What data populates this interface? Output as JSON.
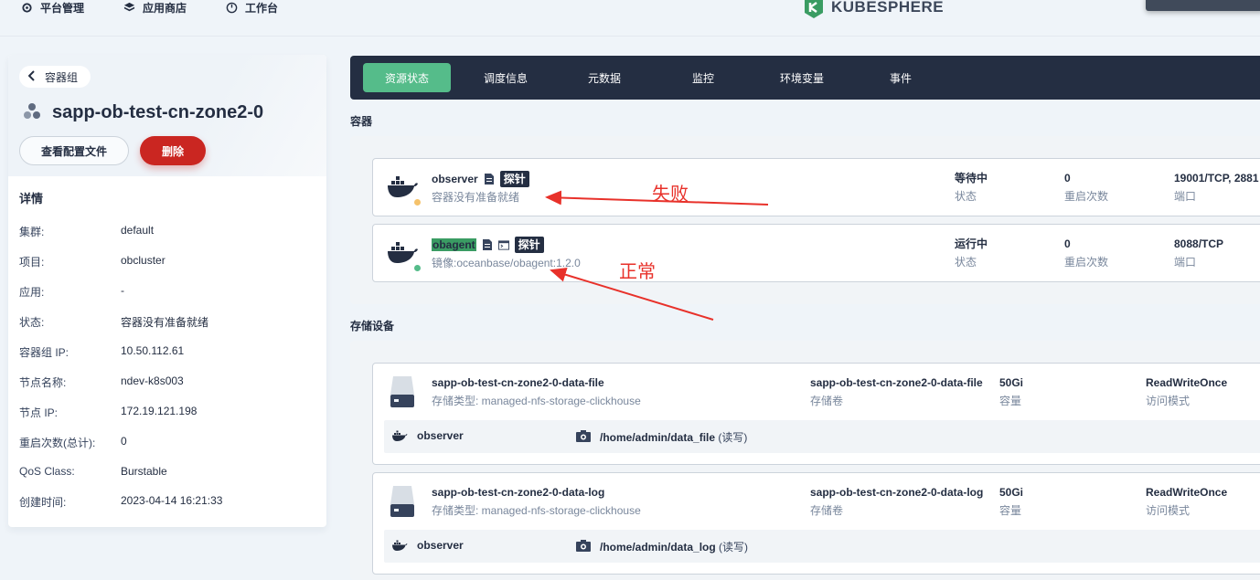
{
  "topnav": {
    "items": [
      {
        "label": "平台管理",
        "icon": "gear-icon"
      },
      {
        "label": "应用商店",
        "icon": "cube-icon"
      },
      {
        "label": "工作台",
        "icon": "dashboard-icon"
      }
    ],
    "logo_text": "KUBESPHERE"
  },
  "sidebar": {
    "back_label": "容器组",
    "pod_name": "sapp-ob-test-cn-zone2-0",
    "view_config_label": "查看配置文件",
    "delete_label": "删除",
    "details_title": "详情",
    "details": [
      {
        "key": "集群:",
        "value": "default"
      },
      {
        "key": "项目:",
        "value": "obcluster"
      },
      {
        "key": "应用:",
        "value": "-"
      },
      {
        "key": "状态:",
        "value": "容器没有准备就绪"
      },
      {
        "key": "容器组 IP:",
        "value": "10.50.112.61"
      },
      {
        "key": "节点名称:",
        "value": "ndev-k8s003"
      },
      {
        "key": "节点 IP:",
        "value": "172.19.121.198"
      },
      {
        "key": "重启次数(总计):",
        "value": "0"
      },
      {
        "key": "QoS Class:",
        "value": "Burstable"
      },
      {
        "key": "创建时间:",
        "value": "2023-04-14 16:21:33"
      }
    ]
  },
  "tabs": [
    {
      "label": "资源状态",
      "active": true
    },
    {
      "label": "调度信息"
    },
    {
      "label": "元数据"
    },
    {
      "label": "监控"
    },
    {
      "label": "环境变量"
    },
    {
      "label": "事件"
    }
  ],
  "containers": {
    "title": "容器",
    "items": [
      {
        "name": "observer",
        "probe": "探针",
        "subtitle": "容器没有准备就绪",
        "status": "等待中",
        "status_label": "状态",
        "restarts": "0",
        "restarts_label": "重启次数",
        "ports": "19001/TCP, 2881",
        "ports_label": "端口",
        "dot_color": "#f5c26b"
      },
      {
        "name": "obagent",
        "probe": "探针",
        "subtitle": "镜像:oceanbase/obagent:1.2.0",
        "status": "运行中",
        "status_label": "状态",
        "restarts": "0",
        "restarts_label": "重启次数",
        "ports": "8088/TCP",
        "ports_label": "端口",
        "dot_color": "#55bc8a"
      }
    ]
  },
  "storage": {
    "title": "存储设备",
    "items": [
      {
        "name": "sapp-ob-test-cn-zone2-0-data-file",
        "storage_type": "存储类型: managed-nfs-storage-clickhouse",
        "volume": "sapp-ob-test-cn-zone2-0-data-file",
        "volume_label": "存储卷",
        "capacity": "50Gi",
        "capacity_label": "容量",
        "access": "ReadWriteOnce",
        "access_label": "访问模式",
        "mount_container": "observer",
        "mount_path": "/home/admin/data_file",
        "mount_mode": "(读写)"
      },
      {
        "name": "sapp-ob-test-cn-zone2-0-data-log",
        "storage_type": "存储类型: managed-nfs-storage-clickhouse",
        "volume": "sapp-ob-test-cn-zone2-0-data-log",
        "volume_label": "存储卷",
        "capacity": "50Gi",
        "capacity_label": "容量",
        "access": "ReadWriteOnce",
        "access_label": "访问模式",
        "mount_container": "observer",
        "mount_path": "/home/admin/data_log",
        "mount_mode": "(读写)"
      }
    ]
  },
  "annotations": {
    "fail": "失败",
    "ok": "正常",
    "color": "#e8312a"
  }
}
